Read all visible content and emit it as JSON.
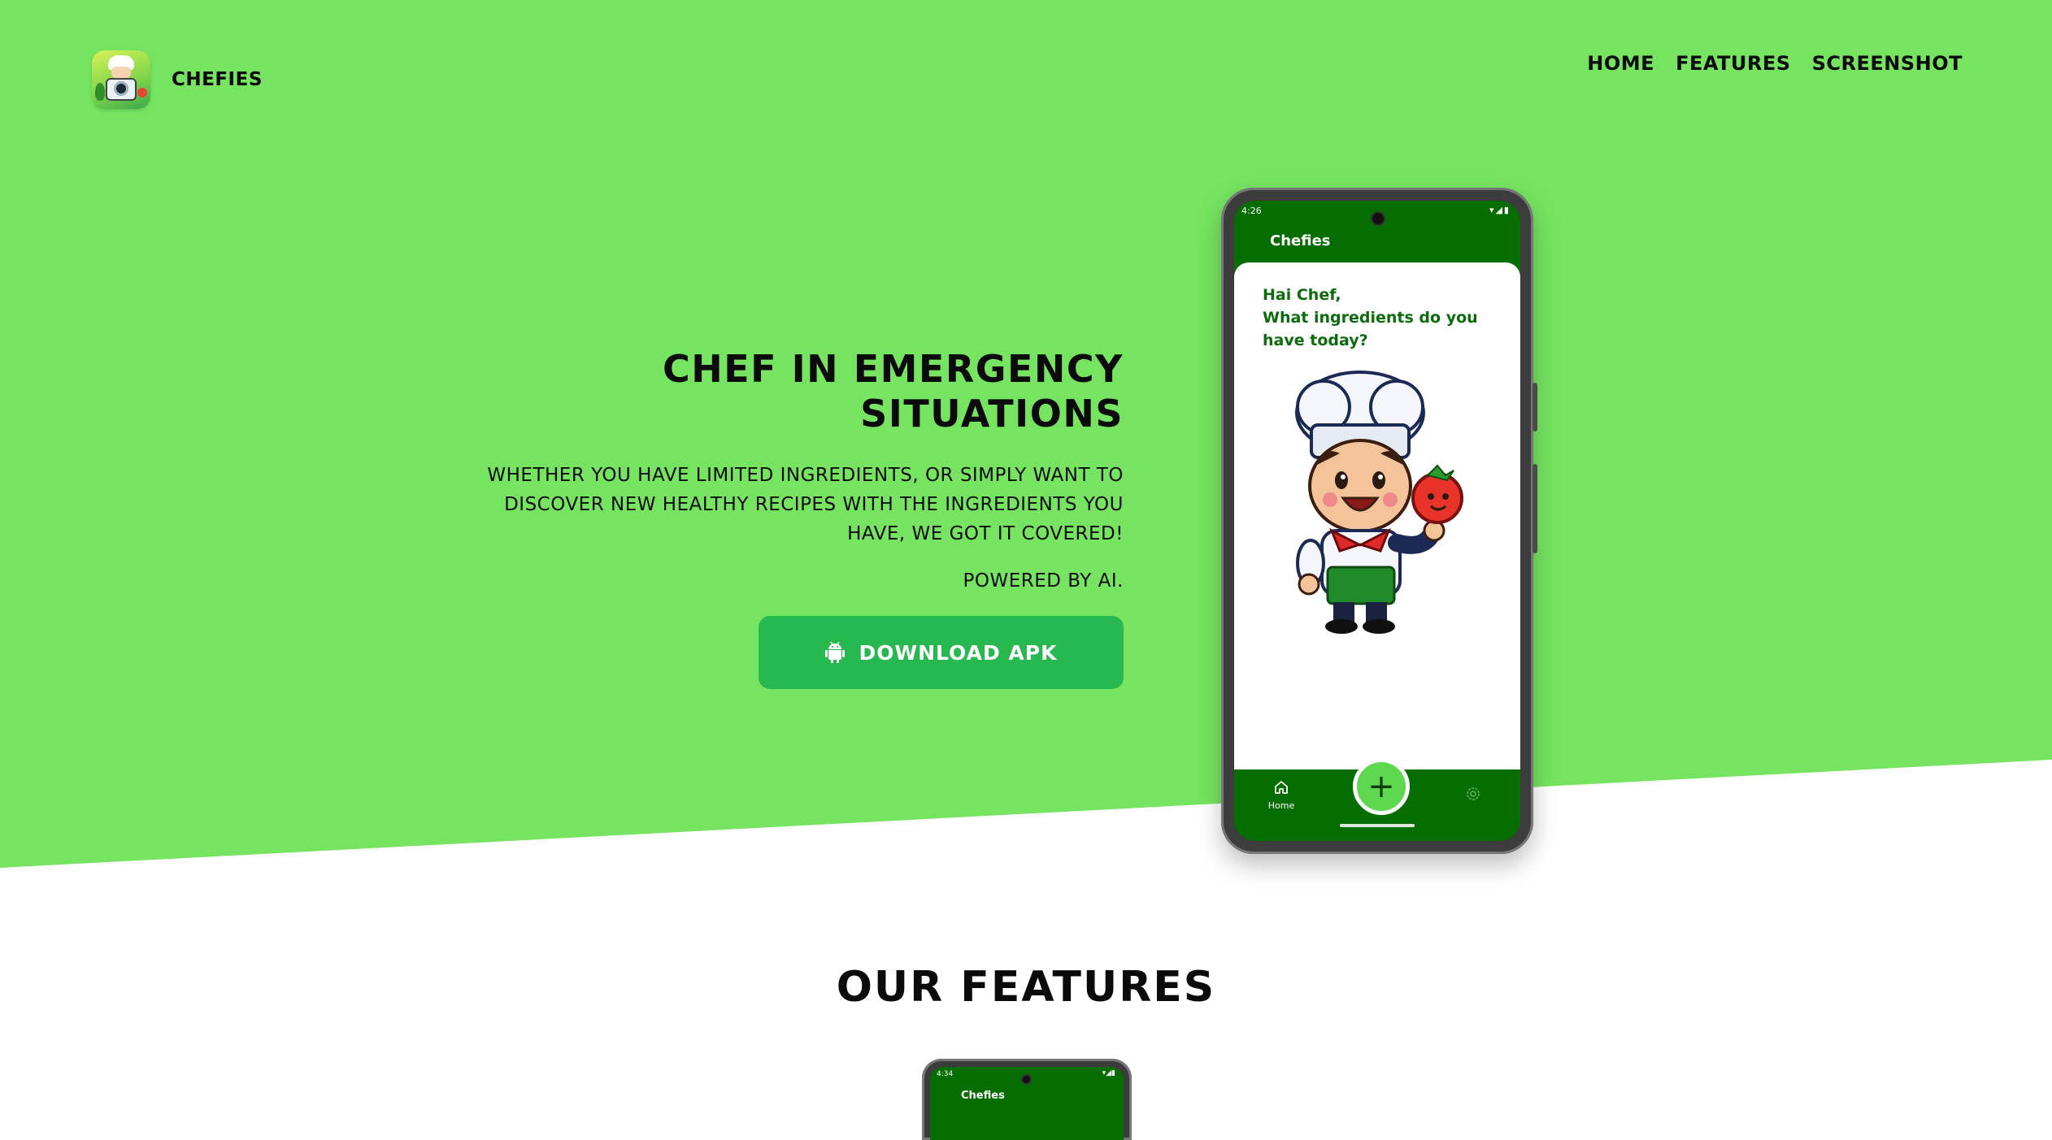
{
  "brand": {
    "name": "CHEFIES",
    "logo_icon": "chef-camera-logo"
  },
  "nav": {
    "items": [
      "HOME",
      "FEATURES",
      "SCREENSHOT"
    ]
  },
  "hero": {
    "title_line1": "CHEF IN EMERGENCY",
    "title_line2": "SITUATIONS",
    "description": "WHETHER YOU HAVE LIMITED INGREDIENTS, OR SIMPLY WANT TO DISCOVER NEW HEALTHY RECIPES WITH THE INGREDIENTS YOU HAVE, WE GOT IT COVERED!",
    "powered_by": "POWERED BY AI.",
    "download_label": "DOWNLOAD APK",
    "download_icon": "android-icon"
  },
  "phone": {
    "status_time": "4:26",
    "status_icons": "▾◢▮",
    "app_title": "Chefies",
    "greeting_line1": "Hai Chef,",
    "greeting_line2": "What ingredients do you have today?",
    "fab_label": "+",
    "nav_home": "Home"
  },
  "features": {
    "title": "OUR FEATURES",
    "phone_status_time": "4:34",
    "phone_status_icons": "▾◢▮",
    "phone_app_title": "Chefies"
  },
  "colors": {
    "hero_green": "#76e461",
    "button_green": "#27b84f",
    "app_dark_green": "#066d00",
    "fab_green": "#5ed84f",
    "greeting_text": "#0c6b0c"
  }
}
